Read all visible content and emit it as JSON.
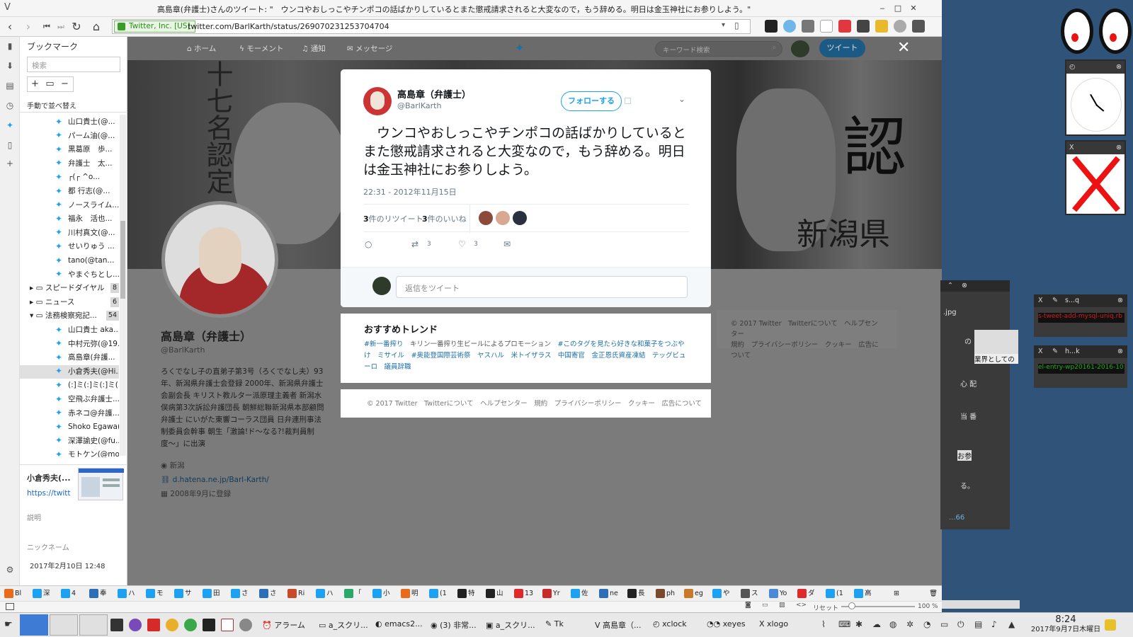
{
  "window": {
    "title": "高島章(弁護士)さんのツイート: \"　ウンコやおしっこやチンポコの話ばかりしているとまた懲戒請求されると大変なので，もう辞める。明日は金玉神社にお参りしよう。\"",
    "minimize": "‒",
    "maximize": "□",
    "close": "✕"
  },
  "address": {
    "security_label": "Twitter, Inc. [US]",
    "url": "twitter.com/BarlKarth/status/269070231253704704"
  },
  "bookmarks_panel": {
    "title": "ブックマーク",
    "search_placeholder": "検索",
    "sort_label": "手動で並べ替え",
    "items": [
      {
        "label": "山口貴士(@...",
        "type": "twitter"
      },
      {
        "label": "パーム油(@...",
        "type": "twitter"
      },
      {
        "label": "黒葛原　歩...",
        "type": "twitter"
      },
      {
        "label": "弁護士　太...",
        "type": "twitter"
      },
      {
        "label": "┌(┌ ^o...",
        "type": "twitter"
      },
      {
        "label": "都 行志(@...",
        "type": "twitter"
      },
      {
        "label": "ノースライム...",
        "type": "twitter"
      },
      {
        "label": "福永　活也...",
        "type": "twitter"
      },
      {
        "label": "川村真文(@...",
        "type": "twitter"
      },
      {
        "label": "せいりゅう ...",
        "type": "twitter"
      },
      {
        "label": "tano(@tan...",
        "type": "twitter"
      },
      {
        "label": "やまぐちとし...",
        "type": "twitter"
      },
      {
        "label": "スピードダイヤル",
        "type": "folder",
        "count": "8",
        "expanded": false
      },
      {
        "label": "ニュース",
        "type": "folder",
        "count": "6",
        "expanded": false
      },
      {
        "label": "法務検察宛記...",
        "type": "folder",
        "count": "54",
        "expanded": true
      },
      {
        "label": "山口貴士 aka...",
        "type": "twitter"
      },
      {
        "label": "中村元弥(@19...",
        "type": "twitter"
      },
      {
        "label": "高島章(弁護...",
        "type": "twitter"
      },
      {
        "label": "小倉秀夫(@Hi...",
        "type": "twitter",
        "selected": true
      },
      {
        "label": "(:]ミ(:]ミ(:]ミ(...",
        "type": "twitter"
      },
      {
        "label": "空飛ぶ弁護士...",
        "type": "twitter"
      },
      {
        "label": "赤ネコ@弁護...",
        "type": "twitter"
      },
      {
        "label": "Shoko Egawa(...",
        "type": "twitter"
      },
      {
        "label": "深澤諭史(@fu...",
        "type": "twitter"
      },
      {
        "label": "モトケン(@mot...",
        "type": "twitter"
      }
    ],
    "detail": {
      "name": "小倉秀夫(...",
      "url": "https://twitt",
      "description_label": "説明",
      "nickname_label": "ニックネーム",
      "date": "2017年2月10日 12:48"
    }
  },
  "twitter_nav": {
    "home": "ホーム",
    "moments": "モーメント",
    "notifications": "通知",
    "messages": "メッセージ",
    "search_placeholder": "キーワード検索",
    "tweet_button": "ツイート",
    "close": "✕"
  },
  "banner_text": {
    "left": "十七名認定",
    "right_big": "認",
    "right_small": "新潟県"
  },
  "profile": {
    "name": "高島章（弁護士）",
    "handle": "@BarlKarth",
    "bio": "ろくでなし子の直弟子第3号（ろくでなし夫）93年、新潟県弁護士会登録 2000年、新潟県弁護士会副会長 キリスト教ルター派原理主義者 新潟水俣病第3次訴訟弁護団長 朝鮮総聯新潟県本部顧問弁護士 にいがた東響コーラス団員 日弁連刑事法制委員会幹事 朝生「激論!ド〜なる?!裁判員制度〜」に出演",
    "location": "新潟",
    "link": "d.hatena.ne.jp/Barl-Karth/",
    "joined": "2008年9月に登録"
  },
  "tweet": {
    "author_name": "高島章（弁護士）",
    "author_handle": "@BarlKarth",
    "follow_label": "フォローする",
    "text": "　ウンコやおしっこやチンポコの話ばかりしているとまた懲戒請求されると大変なので，もう辞める。明日は金玉神社にお参りしよう。",
    "timestamp": "22:31 - 2012年11月15日",
    "retweet_count": "3",
    "retweet_label": "件のリツイート",
    "like_count": "3",
    "like_label": "件のいいね",
    "retweets_inline": "3",
    "likes_inline": "3",
    "reply_placeholder": "返信をツイート"
  },
  "trends": {
    "title": "おすすめトレンド",
    "items": [
      "#新一番搾り",
      "キリン一番搾り生ビールによるプロモーション",
      "#このタグを見たら好きな和菓子をつぶやけ",
      "ミサイル",
      "#奥能登国際芸術祭",
      "ヤスハル",
      "米トイザラス",
      "中国寄官",
      "金正恩氏資産凍結",
      "テッグビューロ",
      "議員辞職"
    ]
  },
  "footer": {
    "text": "© 2017 Twitter　Twitterについて　ヘルプセンター　規約　プライバシーポリシー　クッキー　広告について",
    "right_line1": "© 2017 Twitter　Twitterについて　ヘルプセンター",
    "right_line2": "規約　プライバシーポリシー　クッキー　広告について"
  },
  "bookmark_bar": [
    "Bl",
    "深",
    "4",
    "奉",
    "ハ",
    "モ",
    "サ",
    "田",
    "さ",
    "さ",
    "Ri",
    "ハ",
    "「",
    "小",
    "明",
    "(1",
    "特",
    "山",
    "13",
    "Yr",
    "佐",
    "ne",
    "長",
    "ph",
    "eg",
    "や",
    "ス",
    "Yo",
    "ダ",
    "(1",
    "高"
  ],
  "status": {
    "reset": "リセット",
    "zoom": "100 %"
  },
  "taskbar": {
    "items": [
      "アラーム",
      "a_スクリ...",
      "emacs2...",
      "(3) 非常...",
      "a_スクリ...",
      "Tk",
      "高島章（...",
      "xclock",
      "xeyes",
      "xlogo"
    ],
    "time": "8:24",
    "date": "2017年9月7日木曜日"
  },
  "desktop": {
    "win1_ext": ".jpg",
    "win1_text": "業界としての",
    "win1_lines": [
      "の",
      "心 配",
      "当 番",
      "お参",
      "る。"
    ],
    "win1_bottom": "...66",
    "s_win_title": "s...q",
    "s_win_text": "s-tweet-add-mysql-uniq.rb",
    "h_win_title": "h...k",
    "h_win_text": "el-entry-wp20161-2016-10"
  },
  "colors": {
    "twitter_blue": "#1da1f2",
    "desktop_bg": "#2f5379",
    "modal_bg": "#ffffff"
  }
}
